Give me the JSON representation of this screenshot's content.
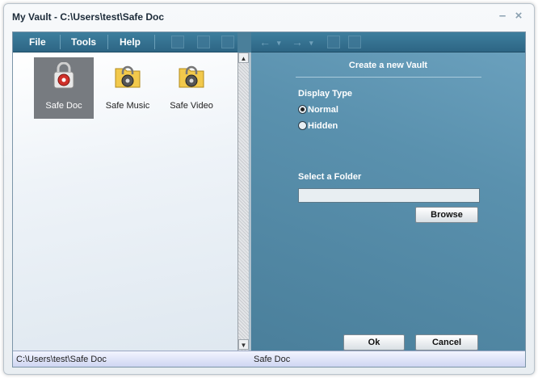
{
  "window": {
    "title": "My Vault - C:\\Users\\test\\Safe Doc",
    "minimize_glyph": "–",
    "close_glyph": "×"
  },
  "menu": {
    "items": [
      {
        "label": "File"
      },
      {
        "label": "Tools"
      },
      {
        "label": "Help"
      }
    ]
  },
  "toolbar": {
    "icons": [
      "save-icon",
      "delete-icon",
      "key-icon"
    ]
  },
  "nav": {
    "back_glyph": "←",
    "forward_glyph": "→",
    "dropdown_glyph": "▾",
    "icons": [
      "back-icon",
      "forward-icon",
      "folder-icon",
      "list-icon"
    ]
  },
  "vaults": {
    "items": [
      {
        "label": "Safe Doc",
        "selected": true
      },
      {
        "label": "Safe Music",
        "selected": false
      },
      {
        "label": "Safe Video",
        "selected": false
      }
    ]
  },
  "form": {
    "title": "Create a new Vault",
    "display_type_label": "Display Type",
    "options": [
      {
        "label": "Normal",
        "checked": true
      },
      {
        "label": "Hidden",
        "checked": false
      }
    ],
    "folder_label": "Select a Folder",
    "folder_value": "",
    "browse_label": "Browse",
    "ok_label": "Ok",
    "cancel_label": "Cancel"
  },
  "status": {
    "path": "C:\\Users\\test\\Safe Doc",
    "name": "Safe Doc"
  },
  "colors": {
    "accent": "#3e7f9e",
    "panel": "#5a91ae",
    "lock_red": "#d0302a",
    "folder_yellow": "#f2c94c"
  }
}
